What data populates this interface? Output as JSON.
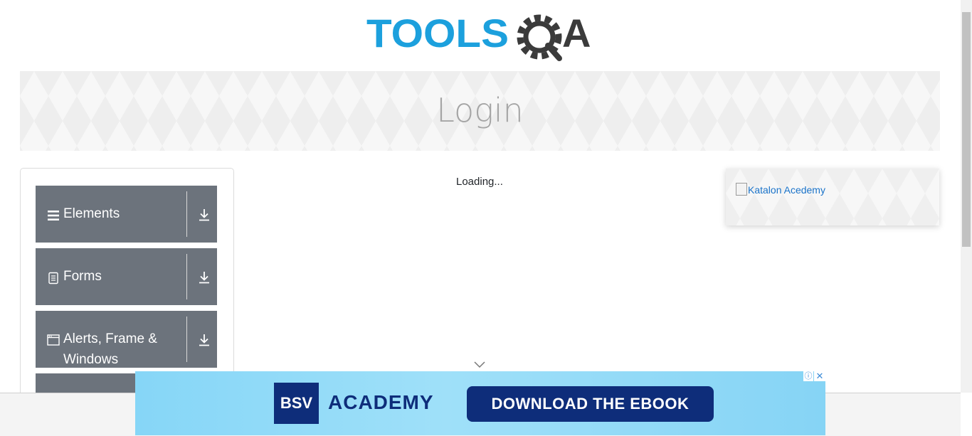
{
  "header": {
    "logo": {
      "word": "TOOLS",
      "suffix_left": "Q",
      "suffix_right": "A",
      "brand_blue": "#1ca0dd",
      "brand_dark": "#3b3b3b"
    }
  },
  "banner": {
    "title": "Login"
  },
  "sidebar": {
    "groups": [
      {
        "label": "Elements",
        "icon": "hamburger-icon"
      },
      {
        "label": "Forms",
        "icon": "document-icon"
      },
      {
        "label": "Alerts, Frame & Windows",
        "icon": "window-icon"
      }
    ],
    "group_color": "#6c737c"
  },
  "main": {
    "loading_text": "Loading..."
  },
  "side_ad": {
    "alt_text": "Katalon Acedemy"
  },
  "bottom_ad": {
    "brand_box": "BSV",
    "brand_text": "ACADEMY",
    "cta": "DOWNLOAD THE EBOOK",
    "info_icon": "ⓘ",
    "close_icon": "✕"
  }
}
